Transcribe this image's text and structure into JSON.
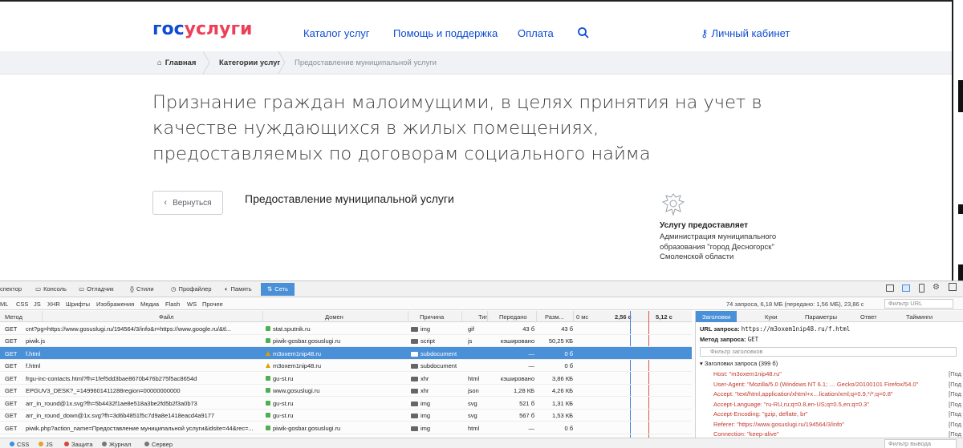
{
  "header": {
    "logo_part1": "гос",
    "logo_part2": "услуги",
    "nav": [
      "Каталог услуг",
      "Помощь и поддержка",
      "Оплата"
    ],
    "cabinet": "Личный кабинет"
  },
  "breadcrumb": {
    "home": "Главная",
    "categories": "Категории услуг",
    "current": "Предоставление муниципальной услуги"
  },
  "page": {
    "title": "Признание граждан малоимущими, в целях принятия на учет в качестве нуждающихся в жилых помещениях, предоставляемых по договорам социального найма",
    "back": "Вернуться",
    "subtitle": "Предоставление муниципальной услуги",
    "provider_label": "Услугу предоставляет",
    "provider_body": "Администрация муниципального образования \"город Десногорск\" Смоленской области"
  },
  "devtools": {
    "tabs": [
      "спектор",
      "Консоль",
      "Отладчик",
      "Стили",
      "Профайлер",
      "Память",
      "Сеть"
    ],
    "filters": [
      "ML",
      "CSS",
      "JS",
      "XHR",
      "Шрифты",
      "Изображения",
      "Медиа",
      "Flash",
      "WS",
      "Прочее"
    ],
    "summary": "74 запроса, 6,18 МБ (передано: 1,56 МБ), 23,86 с",
    "filter_url": "Фильтр URL",
    "columns": [
      "Метод",
      "Файл",
      "Домен",
      "Причина",
      "Тип",
      "Передано",
      "Разм...",
      "0 мс",
      "2,56 с",
      "5,12 с"
    ],
    "rows": [
      {
        "method": "GET",
        "file": "cnt?pg=https://www.gosuslugi.ru/194564/3/info&r=https://www.google.ru/&tl...",
        "domain": "stat.sputnik.ru",
        "cause": "img",
        "type": "gif",
        "transferred": "43 б",
        "size": "43 б",
        "lock": "lock"
      },
      {
        "method": "GET",
        "file": "piwik.js",
        "domain": "piwik-gosbar.gosuslugi.ru",
        "cause": "script",
        "type": "js",
        "transferred": "кэшировано",
        "size": "50,25 КБ",
        "lock": "lock"
      },
      {
        "method": "GET",
        "file": "f.html",
        "domain": "m3oxem1nip48.ru",
        "cause": "subdocument",
        "type": "",
        "transferred": "—",
        "size": "0 б",
        "lock": "warn",
        "selected": true
      },
      {
        "method": "GET",
        "file": "f.html",
        "domain": "m3oxem1nip48.ru",
        "cause": "subdocument",
        "type": "",
        "transferred": "—",
        "size": "0 б",
        "lock": "warn"
      },
      {
        "method": "GET",
        "file": "frgu-inc-contacts.html?fh=1fef5dd3bae8670b476b275f5ac8654d",
        "domain": "gu-st.ru",
        "cause": "xhr",
        "type": "html",
        "transferred": "кэшировано",
        "size": "3,86 КБ",
        "lock": "lock"
      },
      {
        "method": "GET",
        "file": "EPGUV3_DESK?_=1499601411288region=00000000000",
        "domain": "www.gosuslugi.ru",
        "cause": "xhr",
        "type": "json",
        "transferred": "1,28 КБ",
        "size": "4,26 КБ",
        "lock": "lock"
      },
      {
        "method": "GET",
        "file": "arr_in_round@1x.svg?fh=5b4432f1ae8e518a3be2fd5b2f3a0b73",
        "domain": "gu-st.ru",
        "cause": "img",
        "type": "svg",
        "transferred": "521 б",
        "size": "1,31 КБ",
        "lock": "lock"
      },
      {
        "method": "GET",
        "file": "arr_in_round_down@1x.svg?fh=3d6b4851f5c7d9a8e1418eacd4a9177",
        "domain": "gu-st.ru",
        "cause": "img",
        "type": "svg",
        "transferred": "567 б",
        "size": "1,53 КБ",
        "lock": "lock"
      },
      {
        "method": "GET",
        "file": "piwik.php?action_name=Предоставление муниципальной услуги&idsite=44&rec=...",
        "domain": "piwik-gosbar.gosuslugi.ru",
        "cause": "img",
        "type": "html",
        "transferred": "—",
        "size": "0 б",
        "lock": "lock"
      }
    ],
    "side_tabs": [
      "Заголовки",
      "Куки",
      "Параметры",
      "Ответ",
      "Тайминги"
    ],
    "req_url_label": "URL запроса:",
    "req_url": "https://m3oxem1nip48.ru/f.html",
    "req_method_label": "Метод запроса:",
    "req_method": "GET",
    "hdr_filter": "Фильтр заголовков",
    "hdr_section": "Заголовки запроса (399 б)",
    "headers": [
      "Host: \"m3oxem1nip48.ru\"",
      "User-Agent: \"Mozilla/5.0 (Windows NT 6.1; … Gecko/20100101 Firefox/54.0\"",
      "Accept: \"text/html,application/xhtml+x…lication/xml;q=0.9,*/*;q=0.8\"",
      "Accept-Language: \"ru-RU,ru;q=0.8,en-US;q=0.5,en;q=0.3\"",
      "Accept-Encoding: \"gzip, deflate, br\"",
      "Referer: \"https://www.gosuslugi.ru/194564/3/info\"",
      "Connection: \"keep-alive\""
    ],
    "more": "[Под",
    "bottom": [
      "CSS",
      "JS",
      "Защита",
      "Журнал",
      "Сервер"
    ],
    "output_filter": "Фильтр вывода"
  }
}
